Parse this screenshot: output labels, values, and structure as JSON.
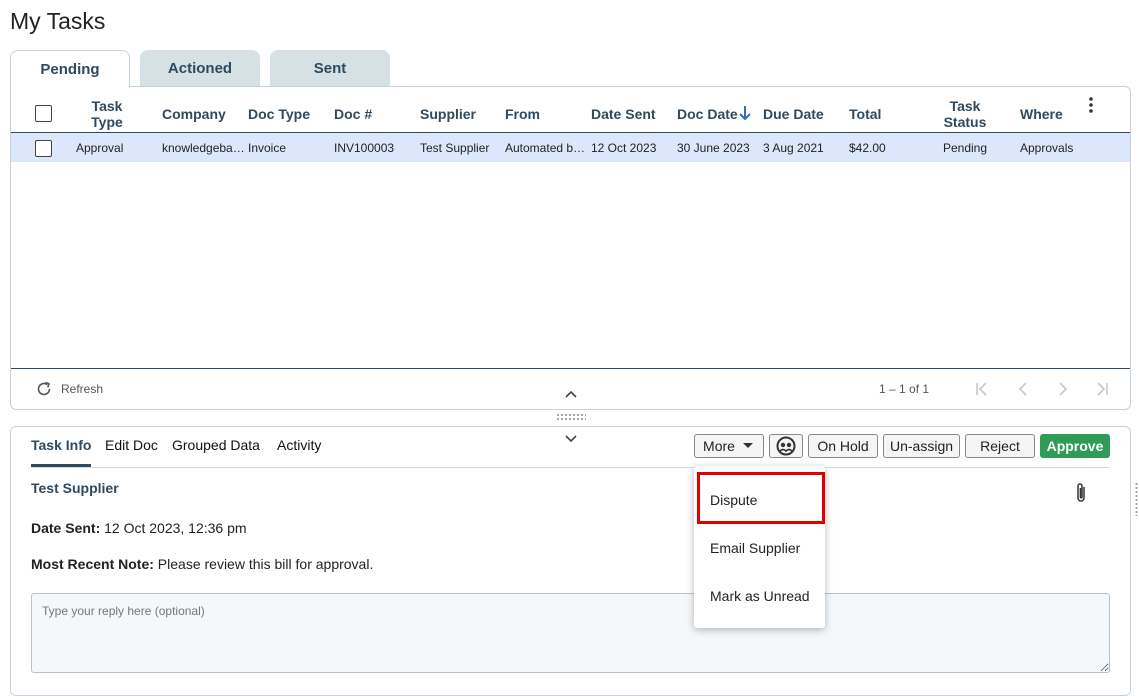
{
  "page": {
    "title": "My Tasks"
  },
  "tabs": [
    {
      "label": "Pending",
      "active": true
    },
    {
      "label": "Actioned",
      "active": false
    },
    {
      "label": "Sent",
      "active": false
    }
  ],
  "table": {
    "headers": {
      "task_type": "Task Type",
      "company": "Company",
      "doc_type": "Doc Type",
      "doc_num": "Doc #",
      "supplier": "Supplier",
      "from": "From",
      "date_sent": "Date Sent",
      "doc_date": "Doc Date",
      "due_date": "Due Date",
      "total": "Total",
      "task_status": "Task Status",
      "where": "Where"
    },
    "sort_icon": "arrow-down-icon",
    "rows": [
      {
        "task_type": "Approval",
        "company": "knowledgeba…",
        "doc_type": "Invoice",
        "doc_num": "INV100003",
        "supplier": "Test Supplier",
        "from": "Automated b…",
        "date_sent": "12 Oct 2023",
        "doc_date": "30 June 2023",
        "due_date": "3 Aug 2021",
        "total": "$42.00",
        "task_status": "Pending",
        "where": "Approvals"
      }
    ]
  },
  "footer": {
    "refresh_label": "Refresh",
    "pagination": "1 – 1 of 1"
  },
  "detail": {
    "tabs": [
      {
        "label": "Task Info",
        "active": true
      },
      {
        "label": "Edit Doc",
        "active": false
      },
      {
        "label": "Grouped Data",
        "active": false
      },
      {
        "label": "Activity",
        "active": false
      }
    ],
    "buttons": {
      "more": "More",
      "on_hold": "On Hold",
      "unassign": "Un-assign",
      "reject": "Reject",
      "approve": "Approve"
    },
    "supplier_name": "Test Supplier",
    "date_sent_label": "Date Sent:",
    "date_sent_value": " 12 Oct 2023, 12:36 pm",
    "note_label": "Most Recent Note:",
    "note_value": " Please review this bill for approval.",
    "reply_placeholder": "Type your reply here (optional)"
  },
  "more_menu": {
    "items": [
      "Dispute",
      "Email Supplier",
      "Mark as Unread"
    ],
    "highlighted": "Dispute"
  },
  "colors": {
    "accent": "#2f4a5e",
    "approve": "#2e9b57",
    "row_selected": "#dde7fb",
    "tab_inactive": "#d5e1e4",
    "highlight": "#e00000"
  }
}
